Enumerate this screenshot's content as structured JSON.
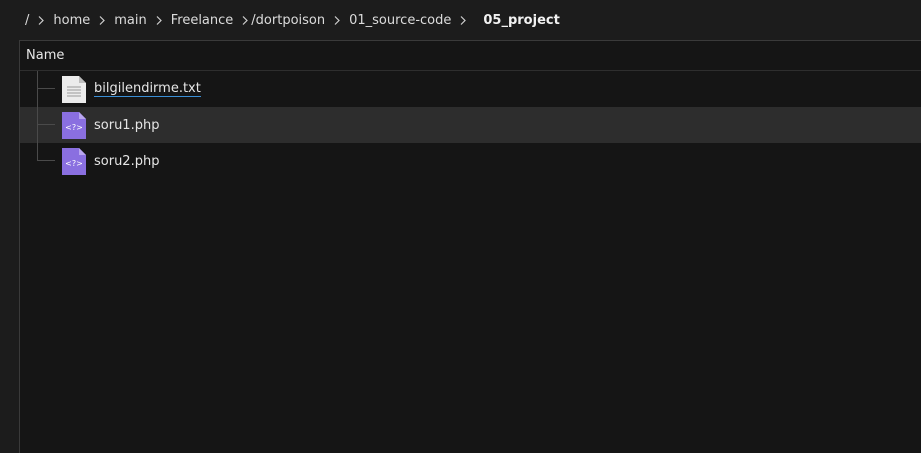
{
  "breadcrumb": {
    "root": "/",
    "segments": [
      "home",
      "main",
      "Freelance",
      "/dortpoison",
      "01_source-code"
    ],
    "current": "05_project"
  },
  "list": {
    "column_name": "Name",
    "files": [
      {
        "name": "bilgilendirme.txt",
        "icon": "text-file-icon",
        "selected": false
      },
      {
        "name": "soru1.php",
        "icon": "php-file-icon",
        "selected": true
      },
      {
        "name": "soru2.php",
        "icon": "php-file-icon",
        "selected": false
      }
    ]
  },
  "colors": {
    "php_icon": "#8a6fe0",
    "txt_icon": "#ececec",
    "selection": "#2d2d2d",
    "underline": "#3a8fd6"
  }
}
